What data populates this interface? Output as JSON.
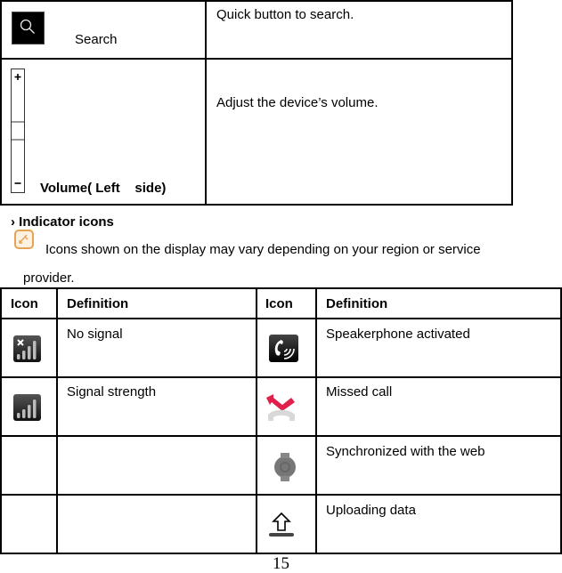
{
  "keys_table": {
    "rows": [
      {
        "icon": "search-key-icon",
        "label": "Search",
        "description": "Quick button to search."
      },
      {
        "icon": "volume-key-icon",
        "label": "Volume( Left    side)",
        "description": "Adjust the device’s volume."
      }
    ]
  },
  "section": {
    "heading_marker": "›",
    "heading": "Indicator icons",
    "note_icon": "note-icon",
    "note_text_line1": "Icons shown on the display may vary depending on your region or service",
    "note_text_line2": "provider."
  },
  "indicator_table": {
    "headers": [
      "Icon",
      "Definition",
      "Icon",
      "Definition"
    ],
    "rows": [
      {
        "left_icon": "no-signal-icon",
        "left_def": "No signal",
        "right_icon": "speakerphone-icon",
        "right_def": "Speakerphone activated"
      },
      {
        "left_icon": "signal-strength-icon",
        "left_def": "Signal strength",
        "right_icon": "missed-call-icon",
        "right_def": "Missed call"
      },
      {
        "left_icon": "",
        "left_def": "",
        "right_icon": "sync-web-icon",
        "right_def": "Synchronized with the web"
      },
      {
        "left_icon": "",
        "left_def": "",
        "right_icon": "uploading-data-icon",
        "right_def": "Uploading data"
      }
    ]
  },
  "page_number": "15"
}
